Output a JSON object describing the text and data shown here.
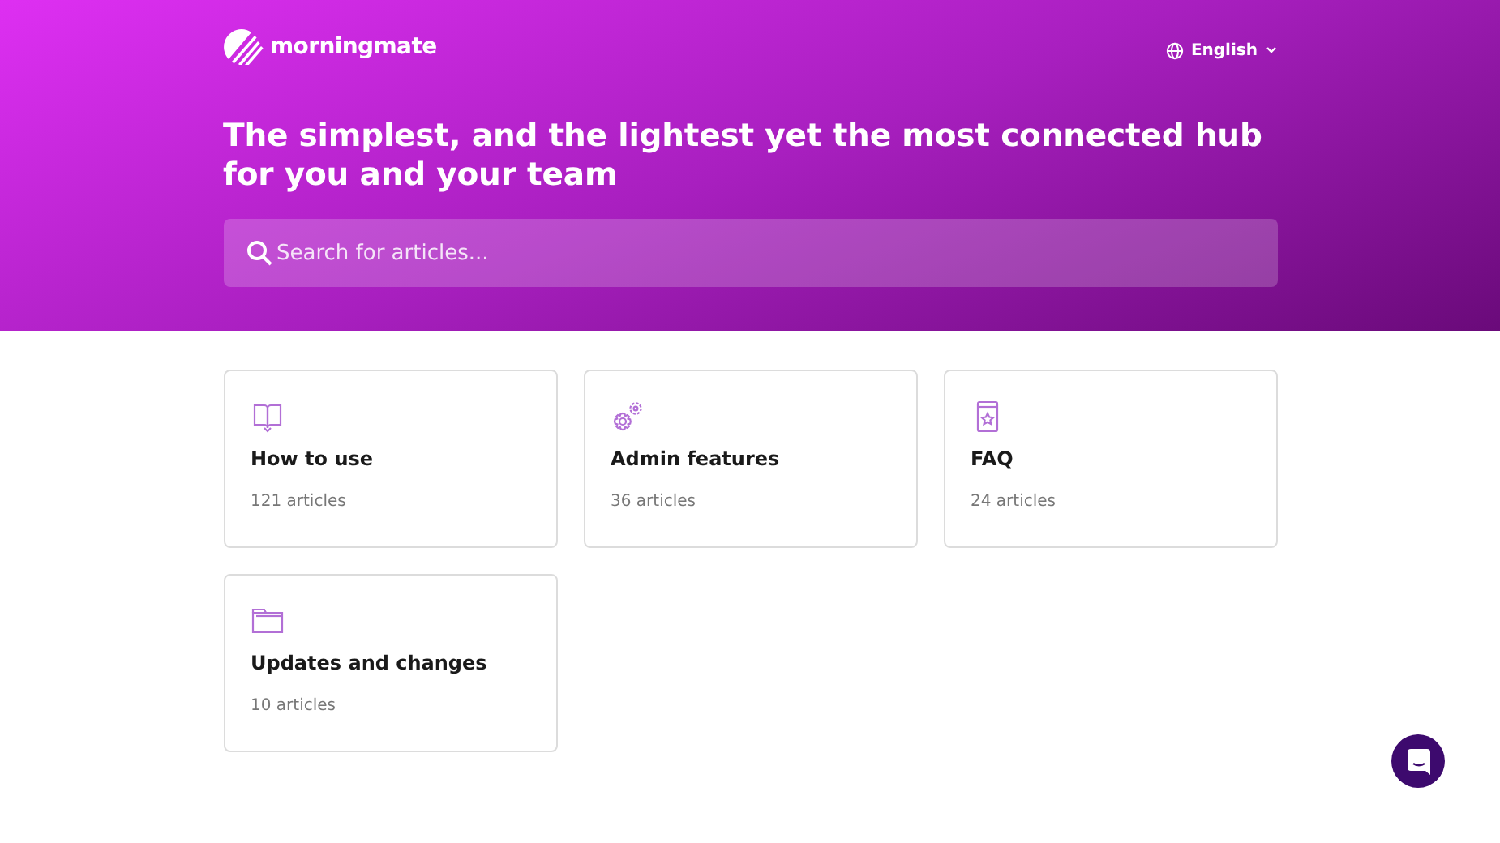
{
  "header": {
    "logo": "morningmate",
    "language": "English",
    "headline": "The simplest, and the lightest yet the most connected hub for you and your team"
  },
  "search": {
    "placeholder": "Search for articles..."
  },
  "collections": [
    {
      "title": "How to use",
      "count": "121 articles"
    },
    {
      "title": "Admin features",
      "count": "36 articles"
    },
    {
      "title": "FAQ",
      "count": "24 articles"
    },
    {
      "title": "Updates and changes",
      "count": "10 articles"
    }
  ]
}
